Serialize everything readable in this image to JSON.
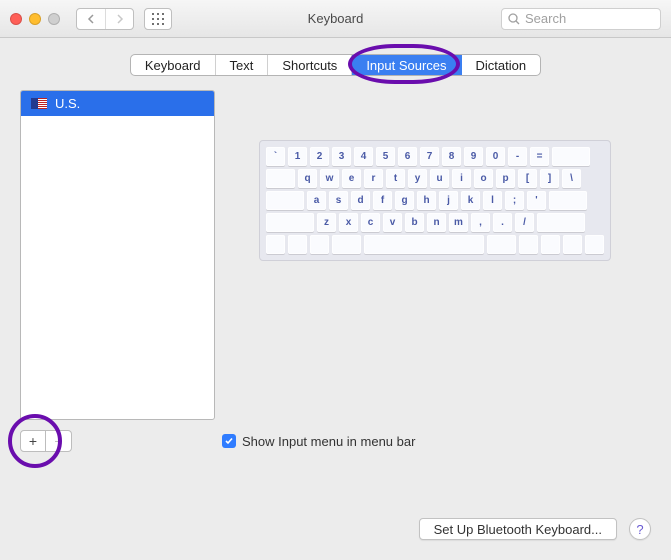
{
  "window": {
    "title": "Keyboard",
    "search_placeholder": "Search"
  },
  "tabs": {
    "items": [
      "Keyboard",
      "Text",
      "Shortcuts",
      "Input Sources",
      "Dictation"
    ],
    "active_index": 3
  },
  "sources": {
    "items": [
      {
        "flag": "us",
        "label": "U.S."
      }
    ],
    "selected_index": 0
  },
  "keyboard_preview": {
    "rows": [
      [
        "`",
        "1",
        "2",
        "3",
        "4",
        "5",
        "6",
        "7",
        "8",
        "9",
        "0",
        "-",
        "="
      ],
      [
        "q",
        "w",
        "e",
        "r",
        "t",
        "y",
        "u",
        "i",
        "o",
        "p",
        "[",
        "]",
        "\\"
      ],
      [
        "a",
        "s",
        "d",
        "f",
        "g",
        "h",
        "j",
        "k",
        "l",
        ";",
        "'"
      ],
      [
        "z",
        "x",
        "c",
        "v",
        "b",
        "n",
        "m",
        ",",
        ".",
        "/"
      ]
    ]
  },
  "controls": {
    "add_label": "+",
    "remove_label": "−",
    "remove_enabled": false,
    "show_input_menu_label": "Show Input menu in menu bar",
    "show_input_menu_checked": true
  },
  "footer": {
    "bluetooth_button": "Set Up Bluetooth Keyboard...",
    "help": "?"
  },
  "annotations": {
    "highlight_tab": "Input Sources",
    "highlight_add_button": true,
    "highlight_color": "#6a0dad"
  }
}
